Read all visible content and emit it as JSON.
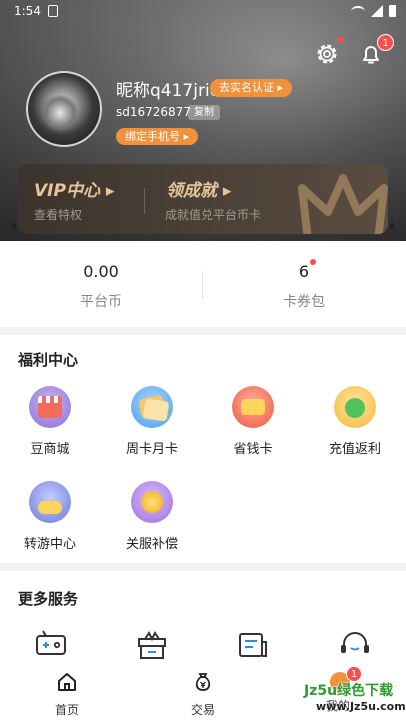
{
  "status_bar": {
    "time": "1:54"
  },
  "header": {
    "settings_icon": "gear-icon",
    "notifications_icon": "bell-icon",
    "notification_count": "1",
    "nickname": "昵称q417jric",
    "verify_label": "去实名认证 ▸",
    "user_id": "sd16726877",
    "copy_label": "复制",
    "bind_phone_label": "绑定手机号 ▸"
  },
  "vip": {
    "left_title": "VIP中心 ▸",
    "left_sub": "查看特权",
    "right_title": "领成就 ▸",
    "right_sub": "成就值兑平台币卡"
  },
  "stats": [
    {
      "value": "0.00",
      "label": "平台币"
    },
    {
      "value": "6",
      "label": "卡券包"
    }
  ],
  "welfare": {
    "title": "福利中心",
    "items": [
      {
        "label": "豆商城",
        "icon": "store-icon",
        "color": "#8a6fd6"
      },
      {
        "label": "周卡月卡",
        "icon": "card-icon",
        "color": "#4f9fe8"
      },
      {
        "label": "省钱卡",
        "icon": "discount-card-icon",
        "color": "#f0553f"
      },
      {
        "label": "充值返利",
        "icon": "rebate-icon",
        "color": "#52c25a"
      },
      {
        "label": "转游中心",
        "icon": "game-transfer-icon",
        "color": "#6c7ad8"
      },
      {
        "label": "关服补偿",
        "icon": "coin-icon",
        "color": "#9f6fd8"
      }
    ]
  },
  "more_services": {
    "title": "更多服务"
  },
  "tabs": [
    {
      "label": "首页",
      "icon": "home-icon"
    },
    {
      "label": "交易",
      "icon": "money-bag-icon"
    },
    {
      "label": "我的",
      "icon": "profile-icon"
    }
  ],
  "tab_badge": "1",
  "watermark": {
    "line1": "Jz5u绿色下载",
    "line2": "www.Jz5u.com"
  }
}
